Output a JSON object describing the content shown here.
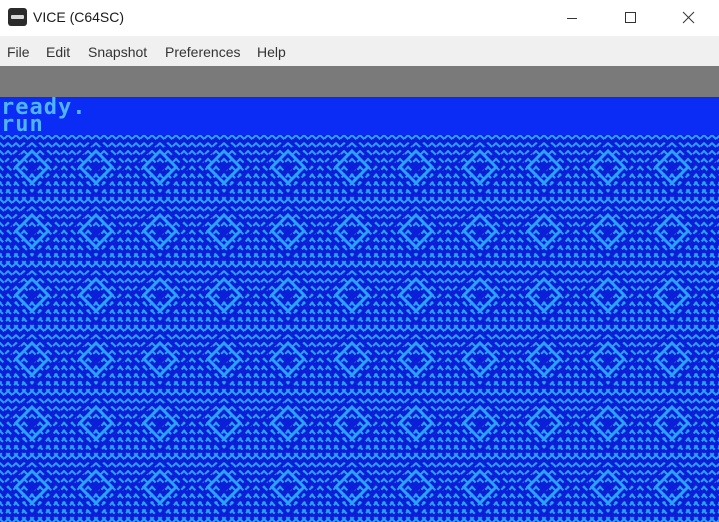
{
  "window": {
    "title": "VICE (C64SC)",
    "icon": "vice-c64-icon",
    "controls": [
      "minimize-icon",
      "maximize-icon",
      "close-icon"
    ]
  },
  "menu": {
    "items": [
      {
        "label": "File"
      },
      {
        "label": "Edit"
      },
      {
        "label": "Snapshot"
      },
      {
        "label": "Preferences"
      },
      {
        "label": "Help"
      }
    ]
  },
  "screen": {
    "lines": [
      "ready.",
      "run"
    ],
    "colors": {
      "border": "#7a7a7a",
      "background": "#0a2cf5",
      "foreground": "#4fb4ff",
      "pattern_dark": "#0d1fd6",
      "pattern_light": "#2aa2ff"
    }
  }
}
